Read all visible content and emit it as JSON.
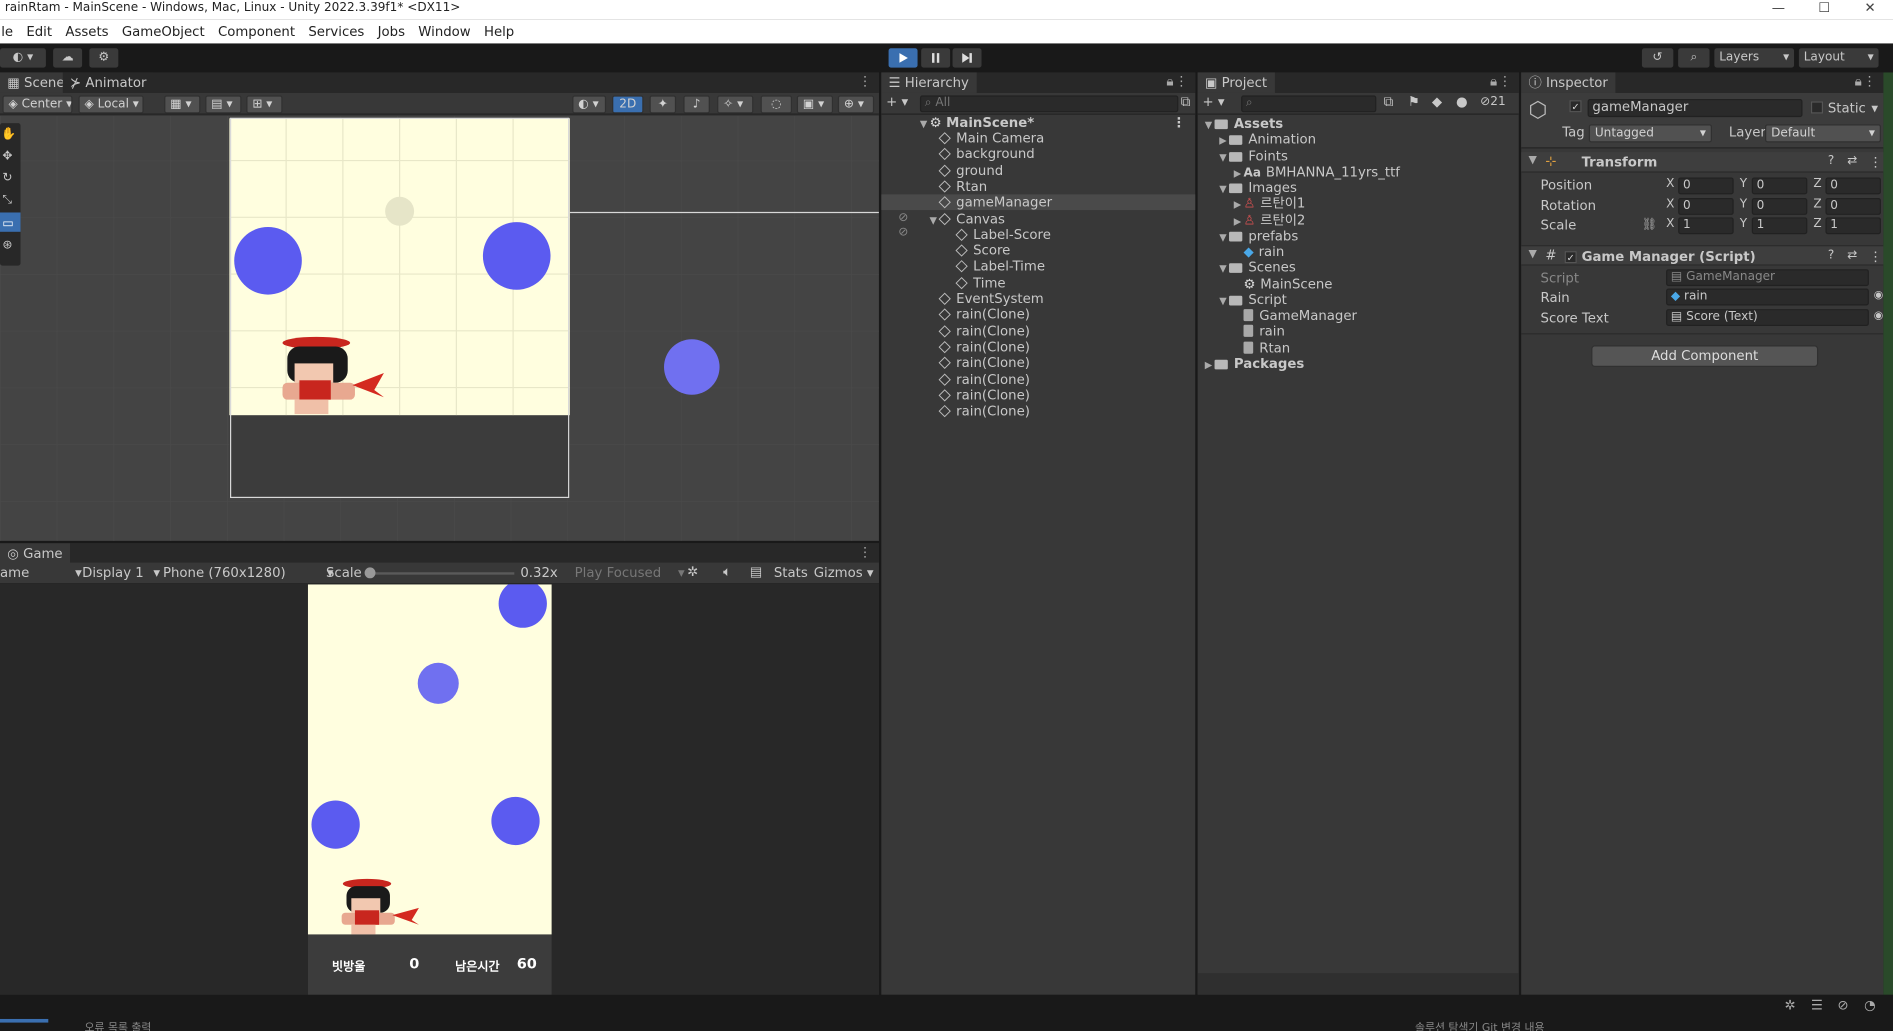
{
  "window": {
    "title": "rainRtam - MainScene - Windows, Mac, Linux - Unity 2022.3.39f1* <DX11>",
    "min": "—",
    "max": "☐",
    "close": "✕"
  },
  "menu": [
    "le",
    "Edit",
    "Assets",
    "GameObject",
    "Component",
    "Services",
    "Jobs",
    "Window",
    "Help"
  ],
  "toolbar": {
    "layers": "Layers",
    "layout": "Layout"
  },
  "scene": {
    "tabs": [
      "Scene",
      "Animator"
    ],
    "pivot": "Center",
    "space": "Local",
    "mode2d": "2D"
  },
  "game": {
    "tab": "Game",
    "mode": "ame",
    "display": "Display 1",
    "resolution": "Phone (760x1280)",
    "scale_label": "Scale",
    "scale_value": "0.32x",
    "play_focused": "Play Focused",
    "stats": "Stats",
    "gizmos": "Gizmos",
    "hud": {
      "score_label": "빗방울",
      "score_value": "0",
      "time_label": "남은시간",
      "time_value": "60"
    }
  },
  "hierarchy": {
    "tab": "Hierarchy",
    "search_placeholder": "All",
    "scene": "MainScene*",
    "items": [
      {
        "label": "Main Camera",
        "indent": 1
      },
      {
        "label": "background",
        "indent": 1
      },
      {
        "label": "ground",
        "indent": 1
      },
      {
        "label": "Rtan",
        "indent": 1
      },
      {
        "label": "gameManager",
        "indent": 1,
        "selected": true
      },
      {
        "label": "Canvas",
        "indent": 1,
        "expanded": true
      },
      {
        "label": "Label-Score",
        "indent": 2
      },
      {
        "label": "Score",
        "indent": 2
      },
      {
        "label": "Label-Time",
        "indent": 2
      },
      {
        "label": "Time",
        "indent": 2
      },
      {
        "label": "EventSystem",
        "indent": 1
      },
      {
        "label": "rain(Clone)",
        "indent": 1
      },
      {
        "label": "rain(Clone)",
        "indent": 1
      },
      {
        "label": "rain(Clone)",
        "indent": 1
      },
      {
        "label": "rain(Clone)",
        "indent": 1
      },
      {
        "label": "rain(Clone)",
        "indent": 1
      },
      {
        "label": "rain(Clone)",
        "indent": 1
      },
      {
        "label": "rain(Clone)",
        "indent": 1
      }
    ]
  },
  "project": {
    "tab": "Project",
    "count": "21",
    "items": [
      {
        "label": "Assets",
        "indent": 0,
        "kind": "folder",
        "expanded": true,
        "bold": true
      },
      {
        "label": "Animation",
        "indent": 1,
        "kind": "folder",
        "expanded": false
      },
      {
        "label": "Foints",
        "indent": 1,
        "kind": "folder",
        "expanded": true
      },
      {
        "label": "BMHANNA_11yrs_ttf",
        "indent": 2,
        "kind": "font",
        "expanded": false
      },
      {
        "label": "Images",
        "indent": 1,
        "kind": "folder",
        "expanded": true
      },
      {
        "label": "르탄이1",
        "indent": 2,
        "kind": "sprite",
        "expanded": false
      },
      {
        "label": "르탄이2",
        "indent": 2,
        "kind": "sprite",
        "expanded": false
      },
      {
        "label": "prefabs",
        "indent": 1,
        "kind": "folder",
        "expanded": true
      },
      {
        "label": "rain",
        "indent": 2,
        "kind": "prefab"
      },
      {
        "label": "Scenes",
        "indent": 1,
        "kind": "folder",
        "expanded": true
      },
      {
        "label": "MainScene",
        "indent": 2,
        "kind": "scene"
      },
      {
        "label": "Script",
        "indent": 1,
        "kind": "folder",
        "expanded": true
      },
      {
        "label": "GameManager",
        "indent": 2,
        "kind": "script"
      },
      {
        "label": "rain",
        "indent": 2,
        "kind": "script"
      },
      {
        "label": "Rtan",
        "indent": 2,
        "kind": "script"
      },
      {
        "label": "Packages",
        "indent": 0,
        "kind": "folder",
        "expanded": false,
        "bold": true
      }
    ]
  },
  "inspector": {
    "tab": "Inspector",
    "object_name": "gameManager",
    "static": "Static",
    "tag_label": "Tag",
    "tag_value": "Untagged",
    "layer_label": "Layer",
    "layer_value": "Default",
    "transform": {
      "title": "Transform",
      "rows": [
        {
          "label": "Position",
          "x": "0",
          "y": "0",
          "z": "0"
        },
        {
          "label": "Rotation",
          "x": "0",
          "y": "0",
          "z": "0"
        },
        {
          "label": "Scale",
          "x": "1",
          "y": "1",
          "z": "1"
        }
      ]
    },
    "script_component": {
      "title": "Game Manager (Script)",
      "script_label": "Script",
      "script_value": "GameManager",
      "rain_label": "Rain",
      "rain_value": "rain",
      "score_label": "Score Text",
      "score_value": "Score (Text)"
    },
    "add_component": "Add Component"
  },
  "statusbar": {
    "left": "오류 목록   출력",
    "right": "솔루션 탐색기   Git 변경 내용"
  },
  "colors": {
    "accent": "#3a6fb0",
    "rain": "#5b5bf0",
    "sky": "#fffedf",
    "ground": "#3c3c3c"
  }
}
